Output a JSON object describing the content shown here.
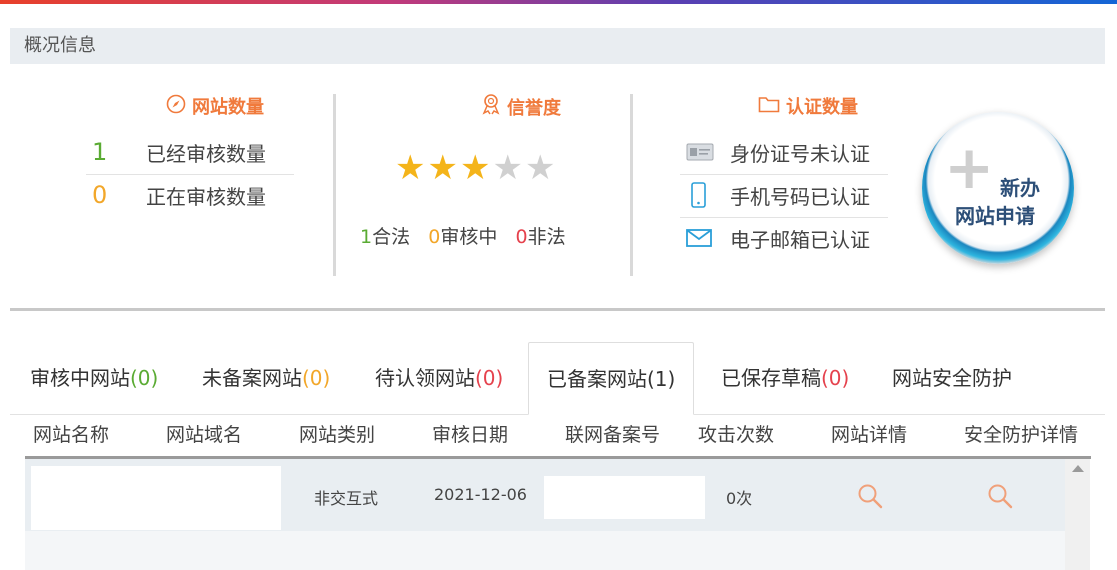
{
  "overview": {
    "title": "概况信息"
  },
  "site_count": {
    "title": "网站数量",
    "rows": [
      {
        "num": "1",
        "label": "已经审核数量"
      },
      {
        "num": "0",
        "label": "正在审核数量"
      }
    ]
  },
  "reputation": {
    "title": "信誉度",
    "rating": 3,
    "max": 5,
    "star_glyphs": [
      "★",
      "★",
      "★",
      "★",
      "★"
    ],
    "legal_num": "1",
    "legal_label": "合法",
    "pending_num": "0",
    "pending_label": "审核中",
    "illegal_num": "0",
    "illegal_label": "非法"
  },
  "certification": {
    "title": "认证数量",
    "items": [
      {
        "icon": "id-card-icon",
        "label": "身份证号未认证"
      },
      {
        "icon": "mobile-phone-icon",
        "label": "手机号码已认证"
      },
      {
        "icon": "envelope-icon",
        "label": "电子邮箱已认证"
      }
    ]
  },
  "new_application": {
    "plus": "+",
    "line1": "新办",
    "line2": "网站申请"
  },
  "tabs": [
    {
      "label": "审核中网站",
      "count": "(0)",
      "count_color": "#5aab33",
      "active": false
    },
    {
      "label": "未备案网站",
      "count": "(0)",
      "count_color": "#f2a72a",
      "active": false
    },
    {
      "label": "待认领网站",
      "count": "(0)",
      "count_color": "#e5424d",
      "active": false
    },
    {
      "label": "已备案网站",
      "count": "(1)",
      "count_color": "#333333",
      "active": true
    },
    {
      "label": "已保存草稿",
      "count": "(0)",
      "count_color": "#e5424d",
      "active": false
    },
    {
      "label": "网站安全防护",
      "count": "",
      "count_color": "#333333",
      "active": false
    }
  ],
  "table": {
    "columns": [
      "网站名称",
      "网站域名",
      "网站类别",
      "审核日期",
      "联网备案号",
      "攻击次数",
      "网站详情",
      "安全防护详情"
    ],
    "rows": [
      {
        "name": "",
        "domain": "",
        "category": "非交互式",
        "date": "2021-12-06",
        "record_no": "",
        "attacks": "0次"
      }
    ]
  },
  "colors": {
    "accent": "#f07a3c",
    "green": "#5aab33",
    "orange": "#f2a72a",
    "red": "#e5424d",
    "blue": "#2a9fd8"
  }
}
